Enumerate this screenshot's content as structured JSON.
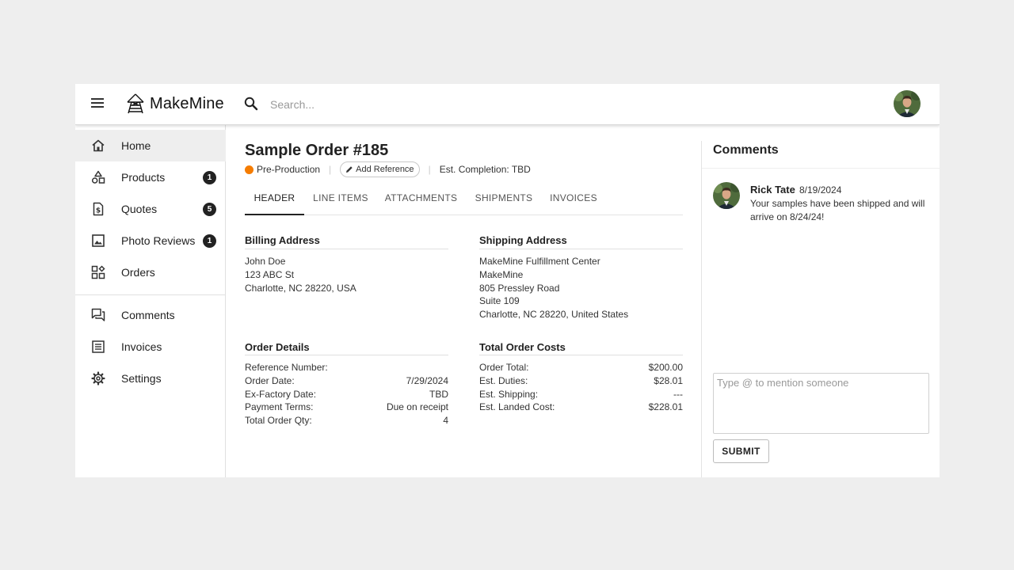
{
  "brand": {
    "name": "MakeMine"
  },
  "search": {
    "placeholder": "Search..."
  },
  "sidebar": {
    "items": [
      {
        "label": "Home",
        "icon": "home-icon",
        "active": true
      },
      {
        "label": "Products",
        "icon": "shapes-icon",
        "badge": "1"
      },
      {
        "label": "Quotes",
        "icon": "dollar-document-icon",
        "badge": "5"
      },
      {
        "label": "Photo Reviews",
        "icon": "image-icon",
        "badge": "1"
      },
      {
        "label": "Orders",
        "icon": "grid-plus-icon"
      },
      {
        "label": "Comments",
        "icon": "chat-icon"
      },
      {
        "label": "Invoices",
        "icon": "receipt-icon"
      },
      {
        "label": "Settings",
        "icon": "gear-icon"
      }
    ]
  },
  "order": {
    "title": "Sample Order #185",
    "status": "Pre-Production",
    "status_color": "#f57c00",
    "add_reference": "Add Reference",
    "est_completion": "Est. Completion: TBD",
    "tabs": [
      "HEADER",
      "LINE ITEMS",
      "ATTACHMENTS",
      "SHIPMENTS",
      "INVOICES"
    ],
    "active_tab": "HEADER",
    "billing": {
      "title": "Billing Address",
      "lines": [
        "John Doe",
        "123 ABC St",
        "Charlotte, NC 28220, USA"
      ]
    },
    "shipping": {
      "title": "Shipping Address",
      "lines": [
        "MakeMine Fulfillment Center",
        "MakeMine",
        "805 Pressley Road",
        "Suite 109",
        "Charlotte, NC 28220, United States"
      ]
    },
    "details": {
      "title": "Order Details",
      "rows": [
        {
          "label": "Reference Number:",
          "value": ""
        },
        {
          "label": "Order Date:",
          "value": "7/29/2024"
        },
        {
          "label": "Ex-Factory Date:",
          "value": "TBD"
        },
        {
          "label": "Payment Terms:",
          "value": "Due on receipt"
        },
        {
          "label": "Total Order Qty:",
          "value": "4"
        }
      ]
    },
    "costs": {
      "title": "Total Order Costs",
      "rows": [
        {
          "label": "Order Total:",
          "value": "$200.00"
        },
        {
          "label": "Est. Duties:",
          "value": "$28.01"
        },
        {
          "label": "Est. Shipping:",
          "value": "---"
        },
        {
          "label": "Est. Landed Cost:",
          "value": "$228.01"
        }
      ]
    }
  },
  "comments": {
    "title": "Comments",
    "items": [
      {
        "author": "Rick Tate",
        "date": "8/19/2024",
        "text": "Your samples have been shipped and will arrive on 8/24/24!"
      }
    ],
    "input_placeholder": "Type @ to mention someone",
    "submit_label": "SUBMIT"
  }
}
